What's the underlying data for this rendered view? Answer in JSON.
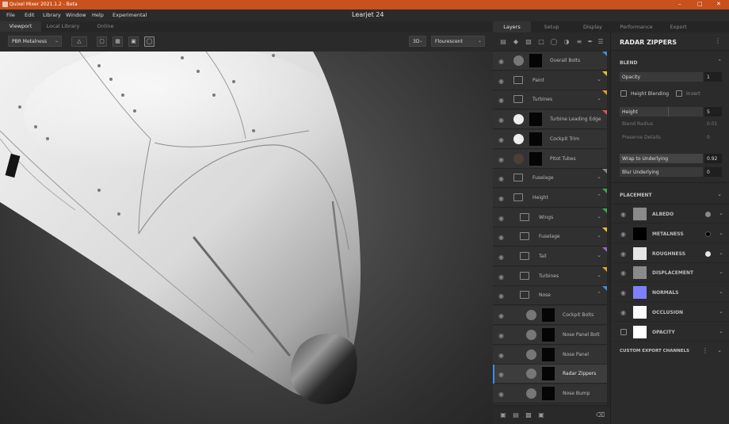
{
  "window": {
    "title": "Quixel Mixer 2021.1.2 - Beta",
    "document": "Learjet 24"
  },
  "colors": {
    "titlebar": "#c8511c",
    "selection_accent": "#3a8ee6"
  },
  "menu": [
    "File",
    "Edit",
    "Library",
    "Window",
    "Help",
    "Experimental"
  ],
  "viewport_tabs": [
    "Viewport",
    "Local Library",
    "Online"
  ],
  "viewport_toolbar": {
    "material_mode": "PBR Metalness",
    "view_mode": "3D",
    "lighting": "Flourescent"
  },
  "panel_tabs": [
    "Layers",
    "Setup",
    "Display",
    "Performance",
    "Export"
  ],
  "layers": [
    {
      "name": "Overall Bolts",
      "type": "layer",
      "swatch": "#777777",
      "flag": "#3a8ee6"
    },
    {
      "name": "Paint",
      "type": "folder",
      "flag": "#e0c530"
    },
    {
      "name": "Turbines",
      "type": "folder",
      "flag": "#e0a020"
    },
    {
      "name": "Turbine Leading Edge",
      "type": "layer",
      "swatch": "#eeeeee",
      "flag": "#e05060"
    },
    {
      "name": "Cockpit Trim",
      "type": "layer",
      "swatch": "#eeeeee"
    },
    {
      "name": "Pitot Tubes",
      "type": "layer",
      "swatch": "#4a4035"
    },
    {
      "name": "Fuselage",
      "type": "folder",
      "flag": "#888888"
    },
    {
      "name": "Height",
      "type": "folder",
      "flag": "#30b040",
      "expanded": true
    },
    {
      "name": "Wings",
      "type": "folder",
      "flag": "#30b040",
      "indent": true
    },
    {
      "name": "Fuselage",
      "type": "folder",
      "flag": "#e0c530",
      "indent": true
    },
    {
      "name": "Tail",
      "type": "folder",
      "flag": "#9a60e0",
      "indent": true
    },
    {
      "name": "Turbines",
      "type": "folder",
      "flag": "#e0a020",
      "indent": true
    },
    {
      "name": "Nose",
      "type": "folder",
      "flag": "#3a8ee6",
      "indent": true,
      "expanded": true
    },
    {
      "name": "Cockpit Bolts",
      "type": "layer",
      "swatch": "#777777",
      "indent2": true
    },
    {
      "name": "Nose Panel Bolt",
      "type": "layer",
      "swatch": "#777777",
      "indent2": true
    },
    {
      "name": "Nose Panel",
      "type": "layer",
      "swatch": "#777777",
      "indent2": true
    },
    {
      "name": "Radar Zippers",
      "type": "layer",
      "swatch": "#777777",
      "indent2": true,
      "selected": true
    },
    {
      "name": "Nose Bump",
      "type": "layer",
      "swatch": "#777777",
      "indent2": true
    }
  ],
  "properties": {
    "title": "RADAR ZIPPERS",
    "blend_section": "BLEND",
    "opacity": {
      "label": "Opacity",
      "value": "1"
    },
    "height_blending": "Height Blending",
    "invert": "Invert",
    "height": {
      "label": "Height",
      "value": "5"
    },
    "blend_radius": {
      "label": "Blend Radius",
      "value": "0.01"
    },
    "preserve_details": {
      "label": "Preserve Details",
      "value": "0"
    },
    "wrap": {
      "label": "Wrap to Underlying",
      "value": "0.92"
    },
    "blur": {
      "label": "Blur Underlying",
      "value": "0"
    },
    "placement_section": "PLACEMENT",
    "channels": [
      {
        "name": "ALBEDO",
        "swatch": "#8a8a8a",
        "dot": "#8a8a8a"
      },
      {
        "name": "METALNESS",
        "swatch": "#000000",
        "dot": "#000000"
      },
      {
        "name": "ROUGHNESS",
        "swatch": "#e6e6e6",
        "dot": "#e6e6e6"
      },
      {
        "name": "DISPLACEMENT",
        "swatch": "#8a8a8a"
      },
      {
        "name": "NORMALS",
        "swatch": "#8080ff"
      },
      {
        "name": "OCCLUSION",
        "swatch": "#ffffff"
      },
      {
        "name": "OPACITY",
        "swatch": "#ffffff",
        "checkbox": true
      }
    ],
    "custom_export": "CUSTOM EXPORT CHANNELS"
  }
}
